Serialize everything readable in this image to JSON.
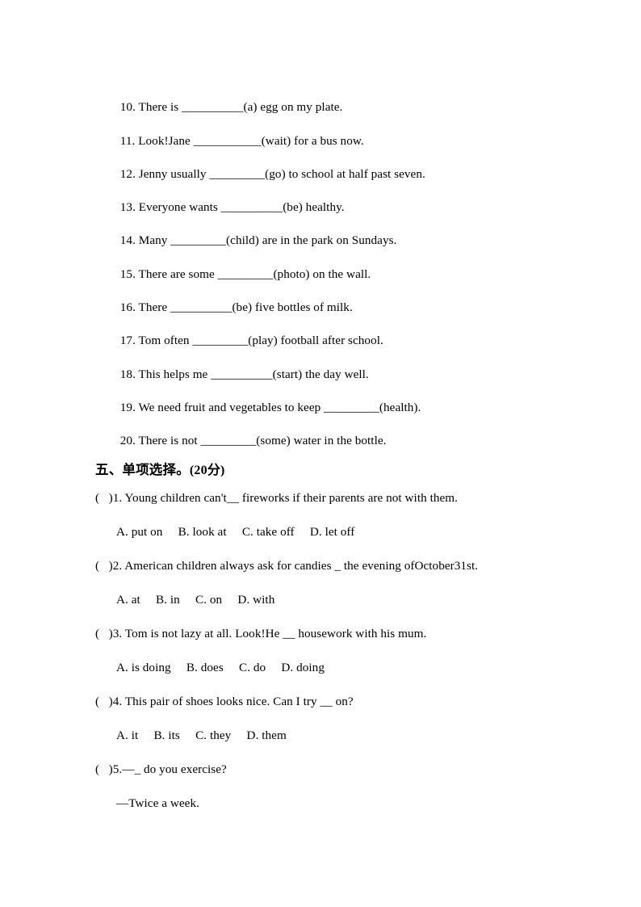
{
  "document": {
    "fill_in_items": [
      {
        "number": "10.",
        "before": " There is ",
        "blank": "__________",
        "after": "(a) egg on my plate."
      },
      {
        "number": "11.",
        "before": " Look!Jane ",
        "blank": "___________",
        "after": "(wait) for a bus now."
      },
      {
        "number": "12.",
        "before": " Jenny usually ",
        "blank": "_________",
        "after": "(go) to school at half past seven."
      },
      {
        "number": "13.",
        "before": " Everyone wants ",
        "blank": "__________",
        "after": "(be) healthy."
      },
      {
        "number": "14.",
        "before": " Many ",
        "blank": "_________",
        "after": "(child) are in the park on Sundays."
      },
      {
        "number": "15.",
        "before": " There are some ",
        "blank": "_________",
        "after": "(photo) on the wall."
      },
      {
        "number": "16.",
        "before": " There ",
        "blank": "__________",
        "after": "(be) five bottles of milk."
      },
      {
        "number": "17.",
        "before": " Tom often ",
        "blank": "_________",
        "after": "(play) football after school."
      },
      {
        "number": "18.",
        "before": " This helps me ",
        "blank": "__________",
        "after": "(start) the day well."
      },
      {
        "number": "19.",
        "before": " We need fruit and vegetables to keep ",
        "blank": "_________",
        "after": "(health)."
      },
      {
        "number": "20.",
        "before": " There is not ",
        "blank": "_________",
        "after": "(some) water in the bottle."
      }
    ],
    "section_heading": {
      "title": "五、单项选择。",
      "score": "(20分)"
    },
    "multiple_choice": [
      {
        "marker": "(   )",
        "number": "1.",
        "question": " Young children can't__ fireworks if their parents are not with them.",
        "options": "A. put on     B. look at     C. take off     D. let off"
      },
      {
        "marker": "(   )",
        "number": "2.",
        "question": " American children always ask for candies _ the evening ofOctober31st.",
        "options": "A. at     B. in     C. on     D. with"
      },
      {
        "marker": "(   )",
        "number": "3.",
        "question": " Tom is not lazy at all. Look!He __ housework with his mum.",
        "options": "A. is doing     B. does     C. do     D. doing"
      },
      {
        "marker": "(   )",
        "number": "4.",
        "question": " This pair of shoes looks nice. Can I try __ on?",
        "options": "A. it     B. its     C. they     D. them"
      },
      {
        "marker": "(   )",
        "number": "5.",
        "question": "—_ do you exercise?",
        "answer": "—Twice a week."
      }
    ]
  }
}
